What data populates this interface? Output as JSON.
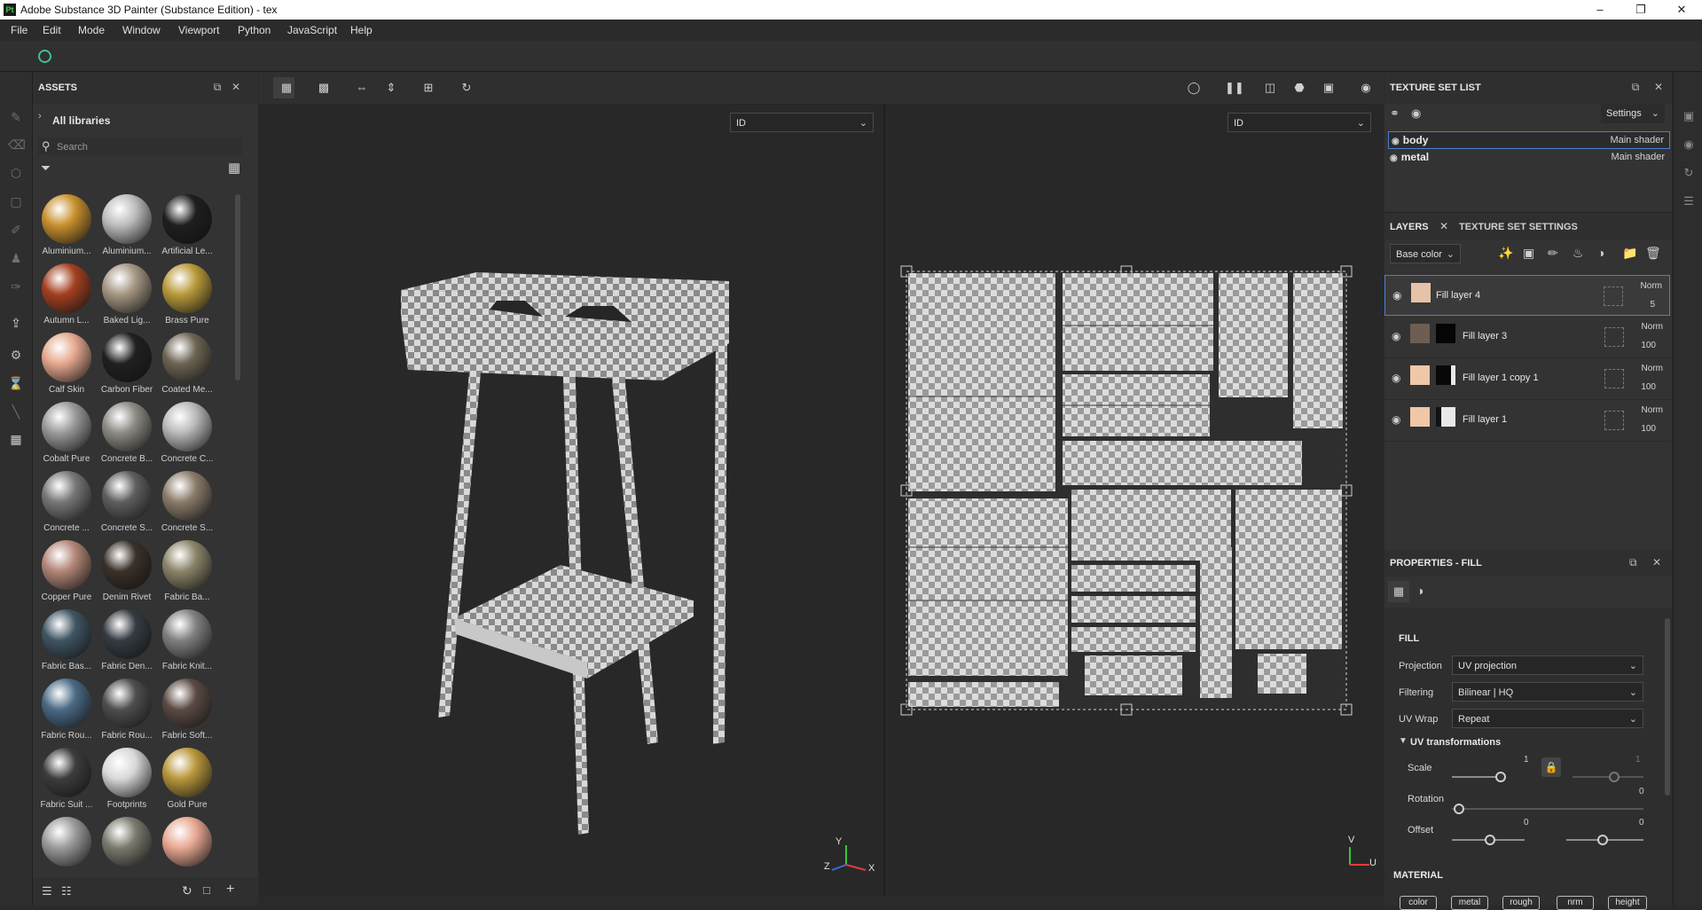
{
  "window": {
    "title": "Adobe Substance 3D Painter (Substance Edition) - tex",
    "logo": "Pt"
  },
  "menu": [
    "File",
    "Edit",
    "Mode",
    "Window",
    "Viewport",
    "Python",
    "JavaScript",
    "Help"
  ],
  "assets": {
    "title": "ASSETS",
    "library": "All libraries",
    "search_placeholder": "Search",
    "materials": [
      {
        "label": "Aluminium...",
        "color": "#c8902e"
      },
      {
        "label": "Aluminium...",
        "color": "#bdbdbd"
      },
      {
        "label": "Artificial Le...",
        "color": "#1e1e1e"
      },
      {
        "label": "Autumn L...",
        "color": "#a3401f"
      },
      {
        "label": "Baked Lig...",
        "color": "#a49682"
      },
      {
        "label": "Brass Pure",
        "color": "#b89a3a"
      },
      {
        "label": "Calf Skin",
        "color": "#e6a88e"
      },
      {
        "label": "Carbon Fiber",
        "color": "#202020"
      },
      {
        "label": "Coated Me...",
        "color": "#6c6453"
      },
      {
        "label": "Cobalt Pure",
        "color": "#9a9a9a"
      },
      {
        "label": "Concrete B...",
        "color": "#8d8a84"
      },
      {
        "label": "Concrete C...",
        "color": "#b9b9b9"
      },
      {
        "label": "Concrete ...",
        "color": "#777777"
      },
      {
        "label": "Concrete S...",
        "color": "#5e5e5e"
      },
      {
        "label": "Concrete S...",
        "color": "#8a7b6a"
      },
      {
        "label": "Copper Pure",
        "color": "#b28677"
      },
      {
        "label": "Denim Rivet",
        "color": "#3a3028"
      },
      {
        "label": "Fabric Ba...",
        "color": "#8a8468"
      },
      {
        "label": "Fabric Bas...",
        "color": "#3f5563"
      },
      {
        "label": "Fabric Den...",
        "color": "#353b42"
      },
      {
        "label": "Fabric Knit...",
        "color": "#808080"
      },
      {
        "label": "Fabric Rou...",
        "color": "#4a6a85"
      },
      {
        "label": "Fabric Rou...",
        "color": "#4e4e4e"
      },
      {
        "label": "Fabric Soft...",
        "color": "#5b4a44"
      },
      {
        "label": "Fabric Suit ...",
        "color": "#3c3c3c"
      },
      {
        "label": "Footprints",
        "color": "#d8d8d8"
      },
      {
        "label": "Gold Pure",
        "color": "#b8963a"
      },
      {
        "label": "",
        "color": "#9a9a9a"
      },
      {
        "label": "",
        "color": "#7b7a6e"
      },
      {
        "label": "",
        "color": "#e8a893"
      }
    ]
  },
  "viewport": {
    "left_channel": "ID",
    "right_channel": "ID",
    "axis_y": "Y",
    "axis_z": "Z",
    "axis_x": "X",
    "uv_v": "V",
    "uv_u": "U"
  },
  "texture_set_list": {
    "title": "TEXTURE SET LIST",
    "settings": "Settings",
    "sets": [
      {
        "name": "body",
        "shader": "Main shader"
      },
      {
        "name": "metal",
        "shader": "Main shader"
      }
    ]
  },
  "layers": {
    "tab_layers": "LAYERS",
    "tab_tss": "TEXTURE SET SETTINGS",
    "channel": "Base color",
    "items": [
      {
        "name": "Fill layer 4",
        "blend": "Norm",
        "opacity": "5",
        "color": "#e6c2a8"
      },
      {
        "name": "Fill layer 3",
        "blend": "Norm",
        "opacity": "100",
        "color": "#6e5d52"
      },
      {
        "name": "Fill layer 1 copy 1",
        "blend": "Norm",
        "opacity": "100",
        "color": "#f0c8a8"
      },
      {
        "name": "Fill layer 1",
        "blend": "Norm",
        "opacity": "100",
        "color": "#f0c8a8"
      }
    ]
  },
  "properties": {
    "title": "PROPERTIES - FILL",
    "section": "FILL",
    "projection_label": "Projection",
    "projection_value": "UV projection",
    "filtering_label": "Filtering",
    "filtering_value": "Bilinear | HQ",
    "uvwrap_label": "UV Wrap",
    "uvwrap_value": "Repeat",
    "uvtrans": "UV transformations",
    "scale_label": "Scale",
    "scale_value": "1",
    "scale_value2": "1",
    "rotation_label": "Rotation",
    "rotation_value": "0",
    "offset_label": "Offset",
    "offset_value": "0",
    "offset_value2": "0",
    "material_label": "MATERIAL",
    "chips": [
      "color",
      "metal",
      "rough",
      "nrm",
      "height"
    ]
  }
}
